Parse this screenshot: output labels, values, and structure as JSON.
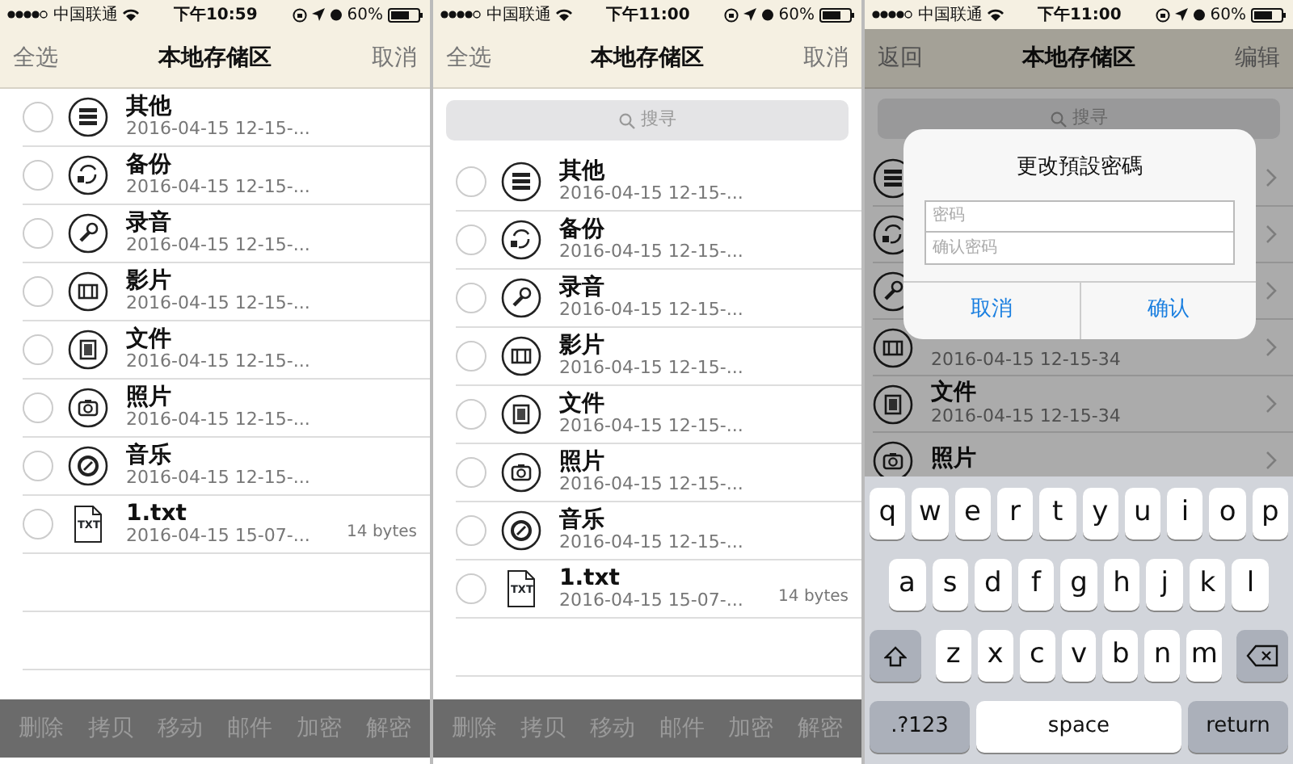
{
  "panels": [
    {
      "kind": "edit",
      "status_bar": {
        "carrier": "中国联通",
        "time": "下午10:59",
        "battery": "60%"
      },
      "nav": {
        "left": "全选",
        "title": "本地存储区",
        "right": "取消"
      },
      "rows": [
        {
          "kind": "stack",
          "title": "其他",
          "date": "2016-04-15 12-15-...",
          "selected": false
        },
        {
          "kind": "backup",
          "title": "备份",
          "date": "2016-04-15 12-15-...",
          "selected": false
        },
        {
          "kind": "mic",
          "title": "录音",
          "date": "2016-04-15 12-15-...",
          "selected": false
        },
        {
          "kind": "film",
          "title": "影片",
          "date": "2016-04-15 12-15-...",
          "selected": false
        },
        {
          "kind": "document",
          "title": "文件",
          "date": "2016-04-15 12-15-...",
          "selected": false
        },
        {
          "kind": "camera",
          "title": "照片",
          "date": "2016-04-15 12-15-...",
          "selected": false
        },
        {
          "kind": "music",
          "title": "音乐",
          "date": "2016-04-15 12-15-...",
          "selected": false
        },
        {
          "kind": "txt",
          "icon_label": "TXT",
          "title": "1.txt",
          "date": "2016-04-15 15-07-...",
          "size": "14 bytes",
          "selected": false
        }
      ],
      "toolbar": [
        "删除",
        "拷贝",
        "移动",
        "邮件",
        "加密",
        "解密"
      ]
    },
    {
      "kind": "edit",
      "status_bar": {
        "carrier": "中国联通",
        "time": "下午11:00",
        "battery": "60%"
      },
      "nav": {
        "left": "全选",
        "title": "本地存储区",
        "right": "取消"
      },
      "search": {
        "placeholder": "搜寻"
      },
      "rows": [
        {
          "kind": "stack",
          "title": "其他",
          "date": "2016-04-15 12-15-...",
          "selected": false
        },
        {
          "kind": "backup",
          "title": "备份",
          "date": "2016-04-15 12-15-...",
          "selected": false
        },
        {
          "kind": "mic",
          "title": "录音",
          "date": "2016-04-15 12-15-...",
          "selected": false
        },
        {
          "kind": "film",
          "title": "影片",
          "date": "2016-04-15 12-15-...",
          "selected": false
        },
        {
          "kind": "document",
          "title": "文件",
          "date": "2016-04-15 12-15-...",
          "selected": false
        },
        {
          "kind": "camera",
          "title": "照片",
          "date": "2016-04-15 12-15-...",
          "selected": false
        },
        {
          "kind": "music",
          "title": "音乐",
          "date": "2016-04-15 12-15-...",
          "selected": false
        },
        {
          "kind": "txt",
          "icon_label": "TXT",
          "title": "1.txt",
          "date": "2016-04-15 15-07-...",
          "size": "14 bytes",
          "selected": false
        }
      ],
      "toolbar": [
        "删除",
        "拷贝",
        "移动",
        "邮件",
        "加密",
        "解密"
      ]
    },
    {
      "kind": "browse",
      "status_bar": {
        "carrier": "中国联通",
        "time": "下午11:00",
        "battery": "60%"
      },
      "nav": {
        "left": "返回",
        "title": "本地存储区",
        "right": "编辑"
      },
      "search": {
        "placeholder": "搜寻"
      },
      "rows": [
        {
          "kind": "stack"
        },
        {
          "kind": "backup"
        },
        {
          "kind": "mic"
        },
        {
          "kind": "film",
          "date": "2016-04-15 12-15-34"
        },
        {
          "kind": "document",
          "title": "文件",
          "date": "2016-04-15 12-15-34"
        },
        {
          "kind": "camera",
          "title": "照片"
        }
      ],
      "dialog": {
        "title": "更改預設密碼",
        "fields": [
          {
            "placeholder": "密码"
          },
          {
            "placeholder": "确认密码"
          }
        ],
        "buttons": [
          "取消",
          "确认"
        ]
      },
      "keyboard": [
        [
          {
            "kind": "letter",
            "label": "q"
          },
          {
            "kind": "letter",
            "label": "w"
          },
          {
            "kind": "letter",
            "label": "e"
          },
          {
            "kind": "letter",
            "label": "r"
          },
          {
            "kind": "letter",
            "label": "t"
          },
          {
            "kind": "letter",
            "label": "y"
          },
          {
            "kind": "letter",
            "label": "u"
          },
          {
            "kind": "letter",
            "label": "i"
          },
          {
            "kind": "letter",
            "label": "o"
          },
          {
            "kind": "letter",
            "label": "p"
          }
        ],
        [
          {
            "kind": "letter",
            "label": "a"
          },
          {
            "kind": "letter",
            "label": "s"
          },
          {
            "kind": "letter",
            "label": "d"
          },
          {
            "kind": "letter",
            "label": "f"
          },
          {
            "kind": "letter",
            "label": "g"
          },
          {
            "kind": "letter",
            "label": "h"
          },
          {
            "kind": "letter",
            "label": "j"
          },
          {
            "kind": "letter",
            "label": "k"
          },
          {
            "kind": "letter",
            "label": "l"
          }
        ],
        [
          {
            "kind": "shift"
          },
          {
            "kind": "letter",
            "label": "z"
          },
          {
            "kind": "letter",
            "label": "x"
          },
          {
            "kind": "letter",
            "label": "c"
          },
          {
            "kind": "letter",
            "label": "v"
          },
          {
            "kind": "letter",
            "label": "b"
          },
          {
            "kind": "letter",
            "label": "n"
          },
          {
            "kind": "letter",
            "label": "m"
          },
          {
            "kind": "delete"
          }
        ],
        [
          {
            "kind": "mode",
            "label": ".?123"
          },
          {
            "kind": "space",
            "label": "space"
          },
          {
            "kind": "return",
            "label": "return"
          }
        ]
      ]
    }
  ]
}
